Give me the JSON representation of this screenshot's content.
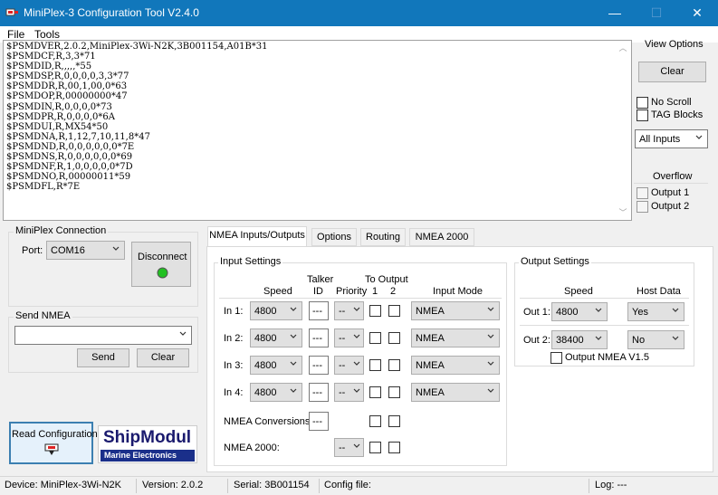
{
  "window": {
    "title": "MiniPlex-3 Configuration Tool V2.4.0",
    "minimize": "—",
    "maximize": "☐",
    "close": "✕"
  },
  "menu": {
    "file": "File",
    "tools": "Tools"
  },
  "log_lines": [
    "$PSMDVER,2.0.2,MiniPlex-3Wi-N2K,3B001154,A01B*31",
    "$PSMDCF,R,3,3*71",
    "$PSMDID,R,,,,,*55",
    "$PSMDSP,R,0,0,0,0,3,3*77",
    "$PSMDDR,R,00,1,00,0*63",
    "$PSMDOP,R,00000000*47",
    "$PSMDIN,R,0,0,0,0*73",
    "$PSMDPR,R,0,0,0,0*6A",
    "$PSMDUI,R,MX54*50",
    "$PSMDNA,R,1,12,7,10,11,8*47",
    "$PSMDND,R,0,0,0,0,0,0*7E",
    "$PSMDNS,R,0,0,0,0,0,0*69",
    "$PSMDNF,R,1,0,0,0,0,0*7D",
    "$PSMDNO,R,00000011*59",
    "$PSMDFL,R*7E"
  ],
  "view_options": {
    "title": "View Options",
    "clear": "Clear",
    "no_scroll": "No Scroll",
    "tag_blocks": "TAG Blocks",
    "inputs_filter": "All Inputs",
    "overflow_title": "Overflow",
    "output1": "Output 1",
    "output2": "Output 2"
  },
  "connection": {
    "title": "MiniPlex Connection",
    "port_label": "Port:",
    "port_value": "COM16",
    "disconnect": "Disconnect",
    "status_color": "#22c022"
  },
  "send_nmea": {
    "title": "Send NMEA",
    "value": "",
    "send": "Send",
    "clear": "Clear"
  },
  "read_config": {
    "label": "Read Configuration",
    "icon": "plug-icon"
  },
  "logo": {
    "main": "ShipModul",
    "sub": "Marine Electronics"
  },
  "tabs": [
    "NMEA Inputs/Outputs",
    "Options",
    "Routing",
    "NMEA 2000"
  ],
  "input_settings": {
    "title": "Input Settings",
    "headers": {
      "speed": "Speed",
      "talker_1": "Talker",
      "talker_2": "ID",
      "priority": "Priority",
      "to_output": "To Output",
      "out1": "1",
      "out2": "2",
      "mode": "Input Mode"
    },
    "rows": [
      {
        "label": "In 1:",
        "speed": "4800",
        "talker": "---",
        "priority": "--",
        "mode": "NMEA"
      },
      {
        "label": "In 2:",
        "speed": "4800",
        "talker": "---",
        "priority": "--",
        "mode": "NMEA"
      },
      {
        "label": "In 3:",
        "speed": "4800",
        "talker": "---",
        "priority": "--",
        "mode": "NMEA"
      },
      {
        "label": "In 4:",
        "speed": "4800",
        "talker": "---",
        "priority": "--",
        "mode": "NMEA"
      }
    ],
    "nmea_conversions": {
      "label": "NMEA Conversions:",
      "talker": "---"
    },
    "nmea_2000": {
      "label": "NMEA 2000:",
      "priority": "--"
    }
  },
  "output_settings": {
    "title": "Output Settings",
    "headers": {
      "speed": "Speed",
      "host": "Host Data"
    },
    "rows": [
      {
        "label": "Out 1:",
        "speed": "4800",
        "host": "Yes"
      },
      {
        "label": "Out 2:",
        "speed": "38400",
        "host": "No"
      }
    ],
    "v15": "Output NMEA V1.5"
  },
  "status": {
    "device": "Device: MiniPlex-3Wi-N2K",
    "version": "Version: 2.0.2",
    "serial": "Serial: 3B001154",
    "config": "Config file:",
    "log": "Log: ---"
  }
}
